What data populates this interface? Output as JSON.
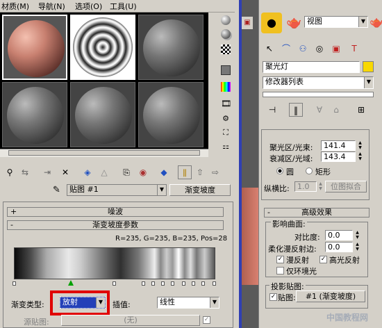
{
  "menu": [
    "材质(M)",
    "导航(N)",
    "选项(O)",
    "工具(U)"
  ],
  "map_name_dropdown": "贴图 #1",
  "map_type_button": "渐变坡度",
  "rollouts": {
    "noise": "噪波",
    "gradient_params": "渐变坡度参数"
  },
  "rgb_readout": "R=235, G=235, B=235, Pos=28",
  "gradient_type_label": "渐变类型:",
  "gradient_type_value": "放射",
  "interp_label": "插值:",
  "interp_value": "线性",
  "source_map_label": "源贴图:",
  "source_map_value": "(无)",
  "right_panel": {
    "viewport_dropdown": "视图",
    "object_name": "聚光灯",
    "modifier_list": "修改器列表",
    "hotspot_label": "聚光区/光束:",
    "hotspot_value": "141.4",
    "falloff_label": "衰减区/光域:",
    "falloff_value": "143.4",
    "circle_label": "圆",
    "rect_label": "矩形",
    "aspect_label": "纵横比:",
    "aspect_value": "1.0",
    "bitmap_fit": "位图拟合",
    "advanced_rollout": "高级效果",
    "affect_surfaces": "影响曲面:",
    "contrast_label": "对比度:",
    "contrast_value": "0.0",
    "soften_label": "柔化漫反射边:",
    "soften_value": "0.0",
    "diffuse_label": "漫反射",
    "specular_label": "高光反射",
    "ambient_label": "仅环境光",
    "projector_label": "投影贴图:",
    "map_check_label": "贴图:",
    "map_value": "#1   (渐变坡度)"
  },
  "watermark": "中国教程网"
}
